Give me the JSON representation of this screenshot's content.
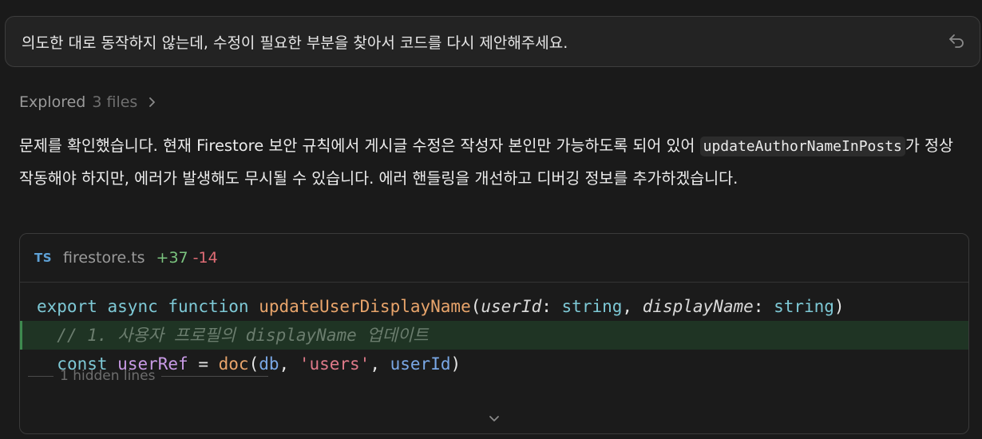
{
  "prompt": {
    "text": "의도한 대로 동작하지 않는데, 수정이 필요한 부분을 찾아서 코드를 다시 제안해주세요."
  },
  "explored": {
    "label": "Explored",
    "count": "3 files"
  },
  "answer": {
    "part1": "문제를 확인했습니다. 현재 Firestore 보안 규칙에서 게시글 수정은 작성자 본인만 가능하도록 되어 있어 ",
    "inline_code": "updateAuthorNameInPosts",
    "part2": "가 정상 작동해야 하지만, 에러가 발생해도 무시될 수 있습니다. 에러 핸들링을 개선하고 디버깅 정보를 추가하겠습니다."
  },
  "code_card": {
    "lang_badge": "TS",
    "filename": "firestore.ts",
    "additions": "+37",
    "deletions": "-14",
    "lines": {
      "l1": {
        "export": "export",
        "async": "async",
        "function": "function",
        "fn_name": "updateUserDisplayName",
        "p_open": "(",
        "param1": "userId",
        "colon1": ": ",
        "type1": "string",
        "comma": ", ",
        "param2": "displayName",
        "colon2": ": ",
        "type2": "string",
        "p_close": ")"
      },
      "l2": {
        "comment": "// 1. 사용자 프로필의 displayName 업데이트"
      },
      "l3": {
        "const": "const",
        "var": "userRef",
        "eq": " = ",
        "call": "doc",
        "open": "(",
        "arg1": "db",
        "c1": ", ",
        "arg2": "'users'",
        "c2": ", ",
        "arg3": "userId",
        "close": ")"
      }
    },
    "hidden_lines": "1 hidden lines"
  },
  "icons": {
    "undo": "undo-icon",
    "chevron_right": "chevron-right-icon",
    "chevron_down": "chevron-down-icon"
  }
}
